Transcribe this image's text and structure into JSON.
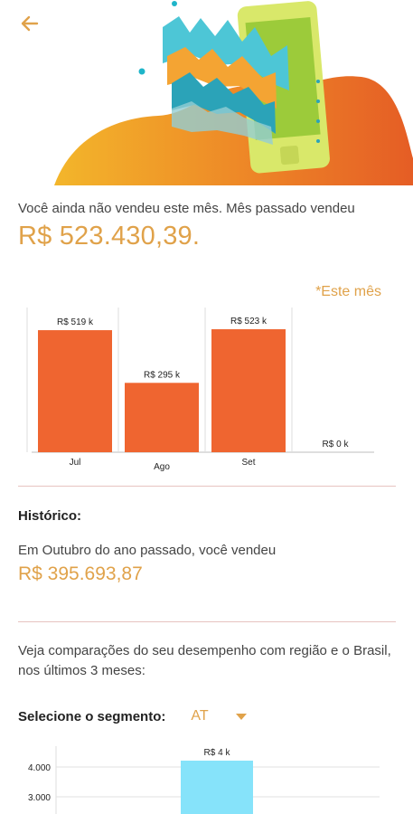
{
  "summary": {
    "text": "Você ainda não vendeu este mês. Mês passado vendeu",
    "amount": "R$ 523.430,39."
  },
  "chart_note": "*Este mês",
  "chart_data": [
    {
      "type": "bar",
      "categories": [
        "Jul",
        "Ago",
        "Set",
        ""
      ],
      "values": [
        519,
        295,
        523,
        0
      ],
      "data_labels": [
        "R$ 519 k",
        "R$ 295 k",
        "R$ 523 k",
        "R$ 0 k"
      ],
      "colors": [
        "#EF6530"
      ],
      "ylim": [
        0,
        600
      ]
    },
    {
      "type": "bar",
      "categories": [
        ""
      ],
      "values": [
        4000
      ],
      "data_labels": [
        "R$ 4 k"
      ],
      "y_ticks": [
        "4.000",
        "3.000"
      ],
      "colors": [
        "#86E3FA"
      ]
    }
  ],
  "historico": {
    "title": "Histórico:",
    "text": "Em Outubro do ano passado, você vendeu",
    "amount": "R$ 395.693,87"
  },
  "compare": {
    "text": "Veja comparações do seu desempenho com região e o Brasil, nos últimos 3 meses:"
  },
  "segment": {
    "label": "Selecione o segmento:",
    "value": "AT"
  },
  "colors": {
    "accent": "#E0A24A",
    "bar": "#EF6530",
    "bar2": "#86E3FA",
    "divider": "#E7C3C0"
  },
  "icons": {
    "back": "arrow-left-icon",
    "dropdown": "triangle-down-icon"
  }
}
